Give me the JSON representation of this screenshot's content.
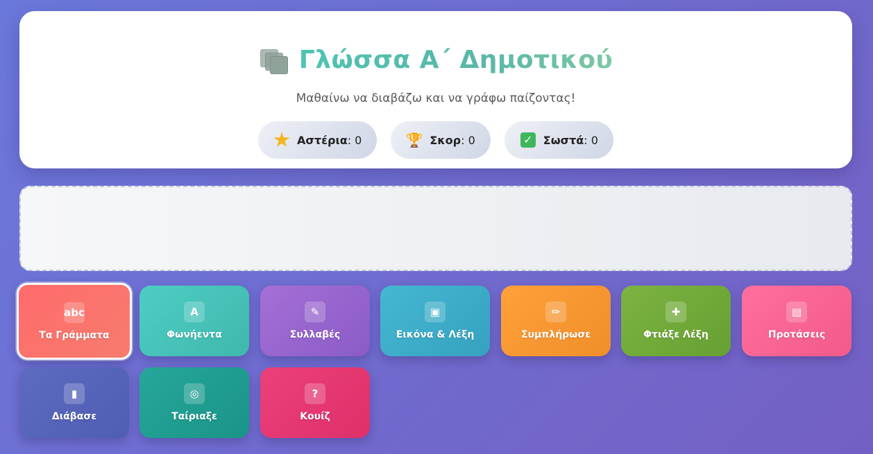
{
  "header": {
    "title": "Γλώσσα Α΄ Δημοτικού",
    "subtitle": "Μαθαίνω να διαβάζω και να γράφω παίζοντας!",
    "stats": [
      {
        "label": "Αστέρια",
        "value": "0",
        "icon": "star-icon"
      },
      {
        "label": "Σκορ",
        "value": "0",
        "icon": "trophy-icon"
      },
      {
        "label": "Σωστά",
        "value": "0",
        "icon": "checkmark-icon"
      }
    ]
  },
  "menu": {
    "items": [
      {
        "label": "Τα Γράμματα",
        "icon": "abc-icon",
        "icon_text": "abc",
        "color_start": "#ff6b6b",
        "color_end": "#f77c6e",
        "active": true
      },
      {
        "label": "Φωνήεντα",
        "icon": "letter-a-icon",
        "icon_text": "A",
        "color_start": "#4ecdc4",
        "color_end": "#3fb8ad"
      },
      {
        "label": "Συλλαβές",
        "icon": "memo-icon",
        "icon_text": "✎",
        "color_start": "#a56fd6",
        "color_end": "#8a5bc7"
      },
      {
        "label": "Εικόνα & Λέξη",
        "icon": "picture-icon",
        "icon_text": "▣",
        "color_start": "#45b7d1",
        "color_end": "#35a2c0"
      },
      {
        "label": "Συμπλήρωσε",
        "icon": "pencil-icon",
        "icon_text": "✏",
        "color_start": "#ffa03a",
        "color_end": "#f08f2a"
      },
      {
        "label": "Φτιάξε Λέξη",
        "icon": "puzzle-icon",
        "icon_text": "✚",
        "color_start": "#7cb342",
        "color_end": "#67a032"
      },
      {
        "label": "Προτάσεις",
        "icon": "open-book-icon",
        "icon_text": "▤",
        "color_start": "#ff6f9e",
        "color_end": "#f25a8a"
      },
      {
        "label": "Διάβασε",
        "icon": "closed-book-icon",
        "icon_text": "▮",
        "color_start": "#5c6bc0",
        "color_end": "#4f5db3"
      },
      {
        "label": "Ταίριαξε",
        "icon": "target-icon",
        "icon_text": "◎",
        "color_start": "#26a69a",
        "color_end": "#1a9488"
      },
      {
        "label": "Κουίζ",
        "icon": "question-icon",
        "icon_text": "?",
        "color_start": "#ec407a",
        "color_end": "#de3069"
      }
    ]
  },
  "colors": {
    "accent": "#4ec3b2",
    "background_start": "#6b78db",
    "background_end": "#7460c4"
  }
}
